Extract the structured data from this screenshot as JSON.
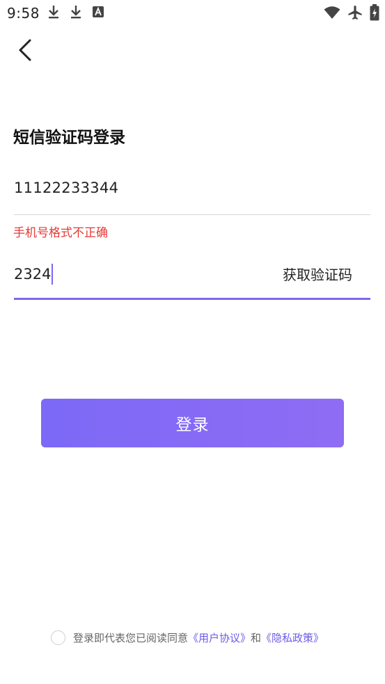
{
  "status_bar": {
    "time": "9:58",
    "left_icons": [
      "download-icon",
      "download-icon",
      "text-a-icon"
    ],
    "right_icons": [
      "wifi-icon",
      "airplane-icon",
      "battery-charging-icon"
    ]
  },
  "page": {
    "back_icon": "chevron-left-icon",
    "title": "短信验证码登录"
  },
  "form": {
    "phone_value": "11122233344",
    "phone_error": "手机号格式不正确",
    "code_value": "2324",
    "get_code_label": "获取验证码",
    "login_label": "登录"
  },
  "agreement": {
    "prefix": "登录即代表您已阅读同意",
    "user_agreement": "《用户协议》",
    "conjunction": "和",
    "privacy_policy": "《隐私政策》"
  },
  "colors": {
    "accent": "#7c68f0",
    "error": "#e53935",
    "link": "#6b5be6"
  }
}
